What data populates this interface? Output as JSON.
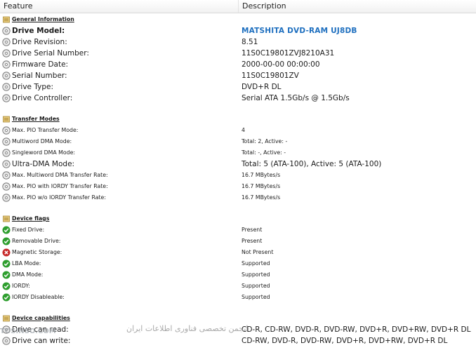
{
  "header": {
    "feature": "Feature",
    "description": "Description"
  },
  "sections": {
    "general": "General Information",
    "transfer": "Transfer Modes",
    "flags": "Device flags",
    "caps": "Device capabilities"
  },
  "general": [
    {
      "f": "Drive Model:",
      "d": "MATSHITA DVD-RAM UJ8DB"
    },
    {
      "f": "Drive Revision:",
      "d": "8.51"
    },
    {
      "f": "Drive Serial Number:",
      "d": "11S0C19801ZVJ8210A31"
    },
    {
      "f": "Firmware Date:",
      "d": "2000-00-00 00:00:00"
    },
    {
      "f": "Serial Number:",
      "d": "11S0C19801ZV"
    },
    {
      "f": "Drive Type:",
      "d": "DVD+R DL"
    },
    {
      "f": "Drive Controller:",
      "d": "Serial ATA 1.5Gb/s @ 1.5Gb/s"
    }
  ],
  "transfer": [
    {
      "f": "Max. PIO Transfer Mode:",
      "d": "4"
    },
    {
      "f": "Multiword DMA Mode:",
      "d": "Total: 2, Active: -"
    },
    {
      "f": "Singleword DMA Mode:",
      "d": "Total: -, Active: -"
    },
    {
      "f": "Ultra-DMA Mode:",
      "d": "Total: 5 (ATA-100), Active: 5 (ATA-100)"
    },
    {
      "f": "Max. Multiword DMA Transfer Rate:",
      "d": "16.7 MBytes/s"
    },
    {
      "f": "Max. PIO with IORDY Transfer Rate:",
      "d": "16.7 MBytes/s"
    },
    {
      "f": "Max. PIO w/o IORDY Transfer Rate:",
      "d": "16.7 MBytes/s"
    }
  ],
  "flags": [
    {
      "f": "Fixed Drive:",
      "d": "Present"
    },
    {
      "f": "Removable Drive:",
      "d": "Present"
    },
    {
      "f": "Magnetic Storage:",
      "d": "Not Present"
    },
    {
      "f": "LBA Mode:",
      "d": "Supported"
    },
    {
      "f": "DMA Mode:",
      "d": "Supported"
    },
    {
      "f": "IORDY:",
      "d": "Supported"
    },
    {
      "f": "IORDY Disableable:",
      "d": "Supported"
    }
  ],
  "caps": [
    {
      "f": "Drive can read:",
      "d": "CD-R, CD-RW, DVD-R, DVD-RW, DVD+R, DVD+RW, DVD+R DL"
    },
    {
      "f": "Drive can write:",
      "d": "CD-RW, DVD-R, DVD-RW, DVD+R, DVD+RW, DVD+R DL"
    }
  ],
  "watermark": {
    "site": "TOSINSO.COM",
    "text": "انجمن تخصصی فناوری اطلاعات ایران"
  },
  "colors": {
    "model": "#1e6fbf",
    "ok": "#2e9e2e",
    "bad": "#c62828",
    "section": "#e0c070"
  }
}
